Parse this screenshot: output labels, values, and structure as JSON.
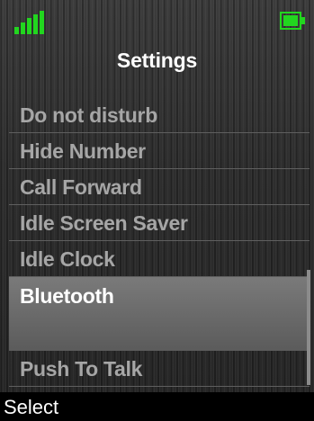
{
  "status": {
    "signal_icon": "signal-strength-icon",
    "battery_icon": "battery-icon",
    "indicator_color": "#22d61f"
  },
  "title": "Settings",
  "menu": {
    "items": [
      {
        "label": "Do not disturb"
      },
      {
        "label": "Hide Number"
      },
      {
        "label": "Call Forward"
      },
      {
        "label": "Idle Screen Saver"
      },
      {
        "label": "Idle Clock"
      },
      {
        "label": "Bluetooth",
        "selected": true
      },
      {
        "label": "Push To Talk"
      }
    ]
  },
  "softkeys": {
    "left": "Select"
  }
}
